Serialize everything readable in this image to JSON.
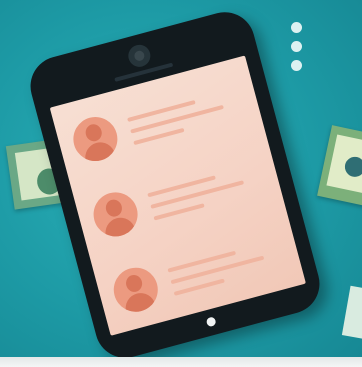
{
  "colors": {
    "background": "#1e9aa6",
    "phone_body": "#121a1e",
    "screen": "#f5d2c4",
    "avatar": "#ec9a80",
    "avatar_figure": "#d9765a",
    "text_line": "#f0b5a0",
    "dots": "#e8f5f5"
  },
  "icons": {
    "menu": "more-vertical-icon",
    "avatar": "person-avatar-icon",
    "camera": "camera-lens-icon",
    "home": "home-button-icon"
  },
  "contacts": [
    {
      "avatar": "person-avatar-icon"
    },
    {
      "avatar": "person-avatar-icon"
    },
    {
      "avatar": "person-avatar-icon"
    }
  ]
}
